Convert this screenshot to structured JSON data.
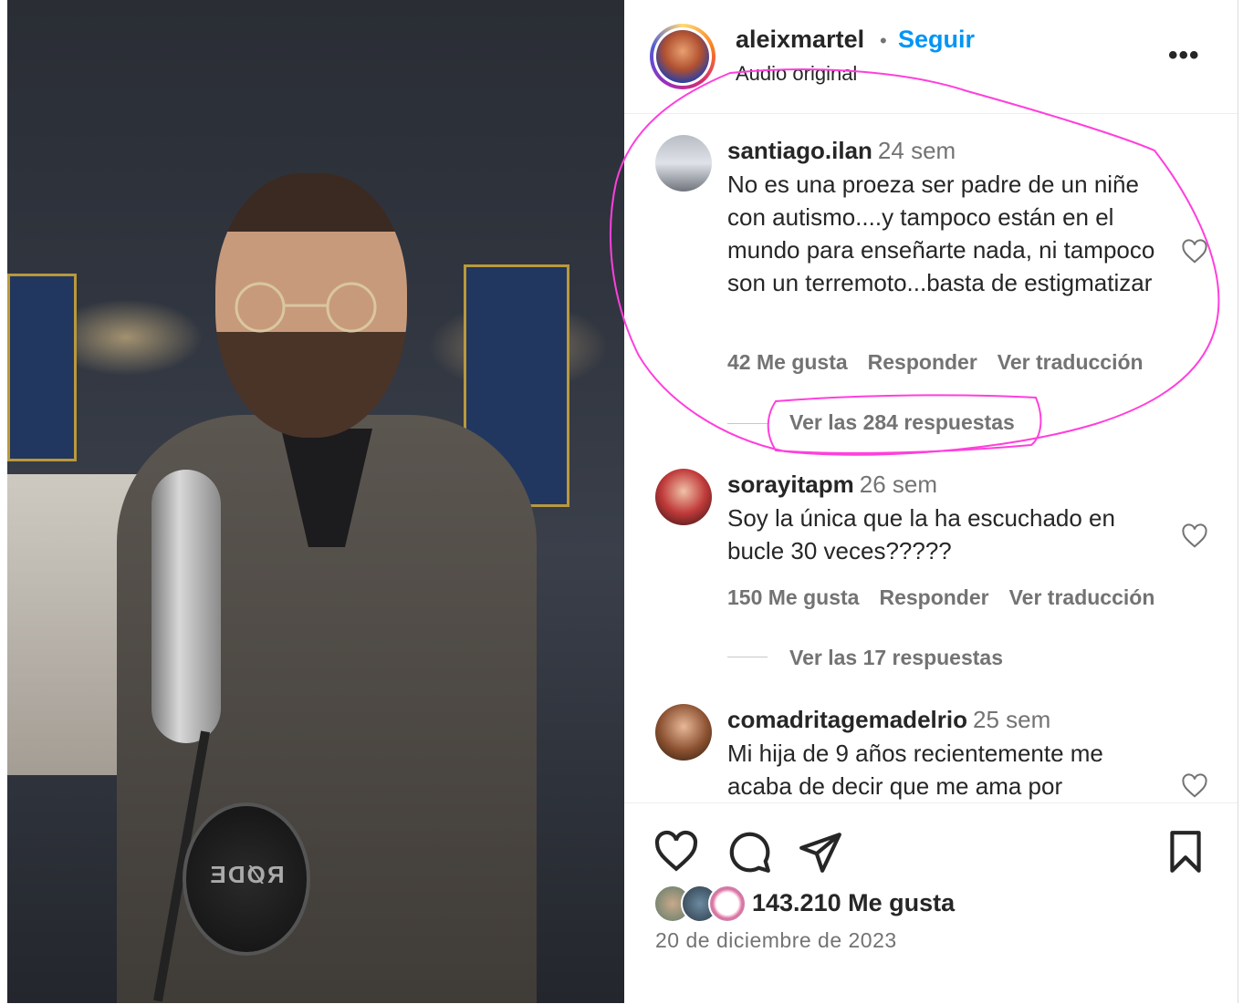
{
  "post": {
    "owner": "aleixmartel",
    "separator": "•",
    "follow_label": "Seguir",
    "audio_label": "Audio original",
    "more_label": "•••",
    "mic_brand": "RØDE"
  },
  "comments": [
    {
      "user": "santiago.ilan",
      "time": "24 sem",
      "text": "No es una proeza ser padre de un niñe con autismo....y tampoco están en el mundo para enseñarte nada, ni tampoco son un terremoto...basta de estigmatizar",
      "likes": "42 Me gusta",
      "reply": "Responder",
      "translate": "Ver traducción",
      "replies": "Ver las 284 respuestas"
    },
    {
      "user": "sorayitapm",
      "time": "26 sem",
      "text": "Soy la única que la ha escuchado en bucle 30 veces?????",
      "likes": "150 Me gusta",
      "reply": "Responder",
      "translate": "Ver traducción",
      "replies": "Ver las 17 respuestas"
    },
    {
      "user": "comadritagemadelrio",
      "time": "25 sem",
      "text": "Mi hija de 9 años recientemente me acaba de decir que me ama por"
    }
  ],
  "footer": {
    "likes_total": "143.210 Me gusta",
    "date": "20 de diciembre de 2023"
  },
  "icons": {
    "like": "heart-icon",
    "comment": "comment-icon",
    "share": "share-icon",
    "save": "bookmark-icon"
  },
  "colors": {
    "follow": "#0095f6",
    "secondary_text": "#737373",
    "annotation": "#ff3fdc"
  }
}
